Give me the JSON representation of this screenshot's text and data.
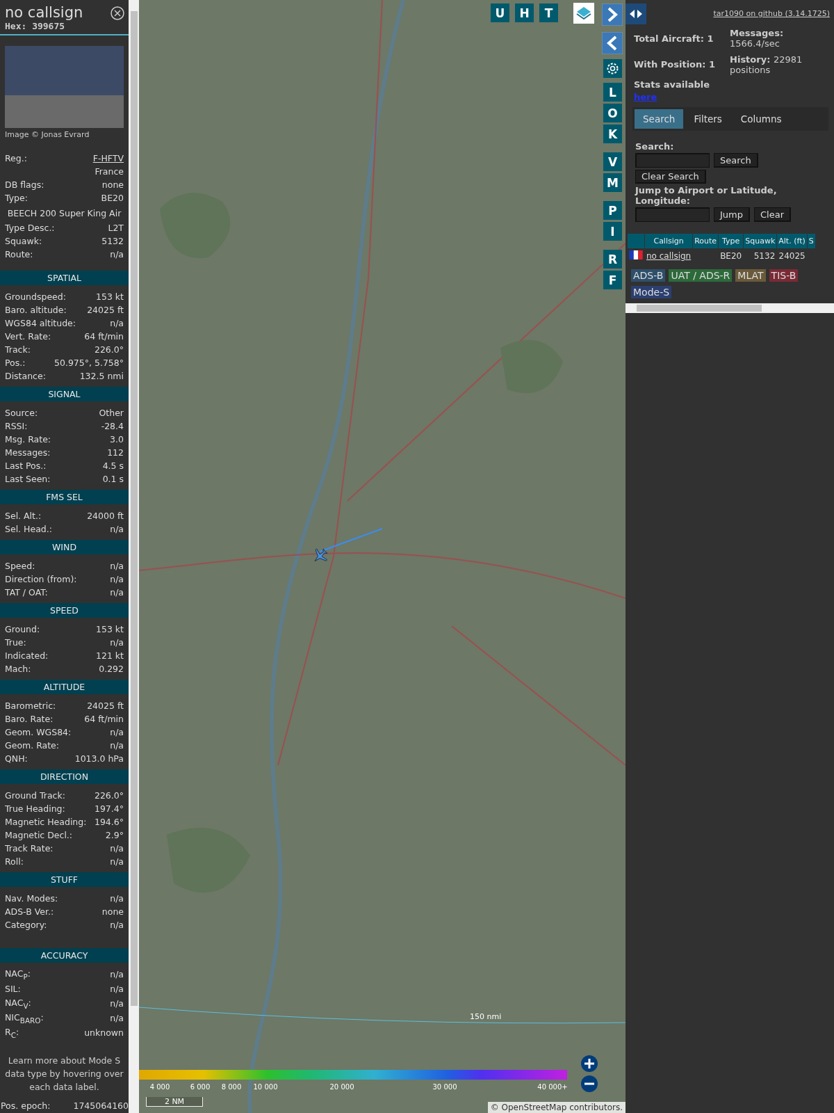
{
  "detail": {
    "title": "no callsign",
    "hex_label": "Hex:",
    "hex": "399675",
    "photo_credit": "Image © Jonas Evrard",
    "rows": [
      {
        "kind": "link",
        "label": "Reg.:",
        "value": "F-HFTV"
      },
      {
        "kind": "value",
        "value": "France"
      },
      {
        "kind": "pair",
        "label": "DB flags:",
        "value": "none"
      },
      {
        "kind": "pair",
        "label": "Type:",
        "value": "BE20"
      },
      {
        "kind": "full",
        "value": "BEECH 200 Super King Air"
      },
      {
        "kind": "pair",
        "label": "Type Desc.:",
        "value": "L2T"
      },
      {
        "kind": "pair",
        "label": "Squawk:",
        "value": "5132"
      },
      {
        "kind": "pair",
        "label": "Route:",
        "value": "n/a"
      }
    ],
    "sections": [
      {
        "title": "SPATIAL",
        "rows": [
          {
            "label": "Groundspeed:",
            "value": "153 kt"
          },
          {
            "label": "Baro. altitude:",
            "value": "24025 ft"
          },
          {
            "label": "WGS84 altitude:",
            "value": "n/a"
          },
          {
            "label": "Vert. Rate:",
            "value": "64 ft/min"
          },
          {
            "label": "Track:",
            "value": "226.0°"
          },
          {
            "label": "Pos.:",
            "value": "50.975°, 5.758°"
          },
          {
            "label": "Distance:",
            "value": "132.5 nmi"
          }
        ]
      },
      {
        "title": "SIGNAL",
        "rows": [
          {
            "label": "Source:",
            "value": "Other"
          },
          {
            "label": "RSSI:",
            "value": "-28.4"
          },
          {
            "label": "Msg. Rate:",
            "value": "3.0"
          },
          {
            "label": "Messages:",
            "value": "112"
          },
          {
            "label": "Last Pos.:",
            "value": "4.5 s"
          },
          {
            "label": "Last Seen:",
            "value": "0.1 s"
          }
        ]
      },
      {
        "title": "FMS SEL",
        "rows": [
          {
            "label": "Sel. Alt.:",
            "value": "24000 ft"
          },
          {
            "label": "Sel. Head.:",
            "value": "n/a"
          }
        ]
      },
      {
        "title": "WIND",
        "rows": [
          {
            "label": "Speed:",
            "value": "n/a"
          },
          {
            "label": "Direction (from):",
            "value": "n/a"
          },
          {
            "label": "TAT / OAT:",
            "value": "n/a"
          }
        ]
      },
      {
        "title": "SPEED",
        "rows": [
          {
            "label": "Ground:",
            "value": "153 kt"
          },
          {
            "label": "True:",
            "value": "n/a"
          },
          {
            "label": "Indicated:",
            "value": "121 kt"
          },
          {
            "label": "Mach:",
            "value": "0.292"
          }
        ]
      },
      {
        "title": "ALTITUDE",
        "rows": [
          {
            "label": "Barometric:",
            "value": "24025 ft"
          },
          {
            "label": "Baro. Rate:",
            "value": "64 ft/min"
          },
          {
            "label": "Geom. WGS84:",
            "value": "n/a"
          },
          {
            "label": "Geom. Rate:",
            "value": "n/a"
          },
          {
            "label": "QNH:",
            "value": "1013.0 hPa"
          }
        ]
      },
      {
        "title": "DIRECTION",
        "rows": [
          {
            "label": "Ground Track:",
            "value": "226.0°"
          },
          {
            "label": "True Heading:",
            "value": "197.4°"
          },
          {
            "label": "Magnetic Heading:",
            "value": "194.6°"
          },
          {
            "label": "Magnetic Decl.:",
            "value": "2.9°"
          },
          {
            "label": "Track Rate:",
            "value": "n/a"
          },
          {
            "label": "Roll:",
            "value": "n/a"
          }
        ]
      },
      {
        "title": "STUFF",
        "rows": [
          {
            "label": "Nav. Modes:",
            "value": "n/a"
          },
          {
            "label": "ADS-B Ver.:",
            "value": "none"
          },
          {
            "label": "Category:",
            "value": "n/a"
          }
        ]
      },
      {
        "title": "ACCURACY",
        "rows": [
          {
            "label": "NAC$_{P}$:",
            "value": "n/a"
          },
          {
            "label": "SIL:",
            "value": "n/a"
          },
          {
            "label": "NAC$_{V}$:",
            "value": "n/a"
          },
          {
            "label": "NIC$_{BARO}$:",
            "value": "n/a"
          },
          {
            "label": "R$_{C}$:",
            "value": "unknown"
          }
        ]
      }
    ],
    "note": "Learn more about Mode S data type by hovering over each data label.",
    "epoch": {
      "label": "Pos. epoch:",
      "value": "1745064160"
    }
  },
  "map": {
    "top_buttons": [
      "U",
      "H",
      "T"
    ],
    "side_buttons": [
      "L",
      "O",
      "K",
      "V",
      "M",
      "P",
      "I",
      "R",
      "F"
    ],
    "legend_ticks": [
      "4 000",
      "6 000",
      "8 000",
      "10 000",
      "20 000",
      "30 000",
      "40 000+"
    ],
    "scale": "2 NM",
    "range_ring": "150 nmi",
    "attribution_prefix": "©",
    "attribution_link": "OpenStreetMap",
    "attribution_suffix": "contributors."
  },
  "panel": {
    "github": "tar1090 on github (3.14.1725)",
    "stats": [
      {
        "label": "Total Aircraft:",
        "value": "1"
      },
      {
        "label": "With Position:",
        "value": "1"
      },
      {
        "label": "Messages:",
        "value": "1566.4/sec"
      },
      {
        "label": "History:",
        "value": "22981 positions"
      }
    ],
    "stats_link_label": "Stats available",
    "stats_link": "here",
    "tabs": [
      {
        "label": "Search",
        "selected": true
      },
      {
        "label": "Filters",
        "selected": false
      },
      {
        "label": "Columns",
        "selected": false
      }
    ],
    "search_label": "Search:",
    "search_button": "Search",
    "clear_search_button": "Clear Search",
    "jump_label": "Jump to Airport or Latitude, Longitude:",
    "jump_button": "Jump",
    "clear_button": "Clear",
    "columns": [
      "Callsign",
      "Route",
      "Type",
      "Squawk",
      "Alt. (ft)",
      "S"
    ],
    "rows": [
      {
        "callsign": "no callsign",
        "type": "BE20",
        "squawk": "5132",
        "alt": "24025",
        "selected": false
      }
    ],
    "sources": [
      {
        "label": "ADS-B",
        "color": "#2e4f6b"
      },
      {
        "label": "UAT / ADS-R",
        "color": "#2d6a3a"
      },
      {
        "label": "MLAT",
        "color": "#6a5a3a"
      },
      {
        "label": "TIS-B",
        "color": "#7a2a35"
      },
      {
        "label": "Mode-S",
        "color": "#2b3f70"
      }
    ]
  }
}
